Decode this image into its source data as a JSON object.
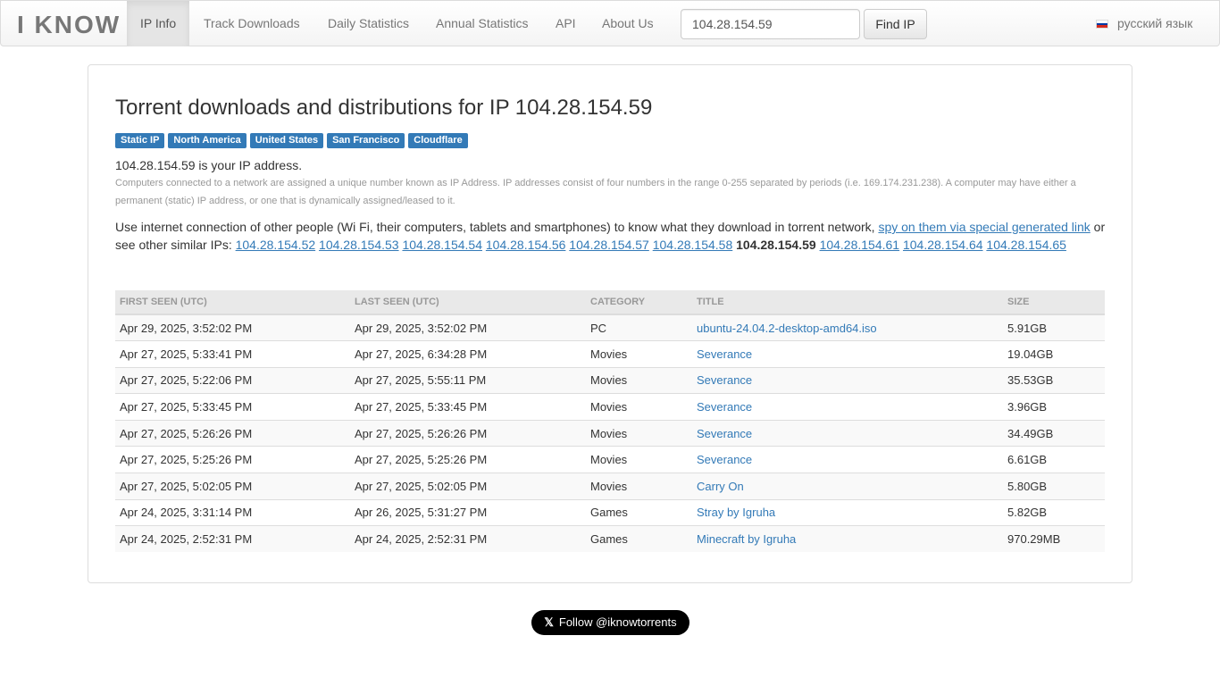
{
  "navbar": {
    "brand": "I KNOW",
    "items": [
      {
        "label": "IP Info"
      },
      {
        "label": "Track Downloads"
      },
      {
        "label": "Daily Statistics"
      },
      {
        "label": "Annual Statistics"
      },
      {
        "label": "API"
      },
      {
        "label": "About Us"
      }
    ],
    "search_value": "104.28.154.59",
    "find_label": "Find IP",
    "lang_label": "русский язык",
    "flag_colors": [
      "#ffffff",
      "#0039a6",
      "#d52b1e"
    ]
  },
  "main": {
    "title": "Torrent downloads and distributions for IP 104.28.154.59",
    "labels": [
      "Static IP",
      "North America",
      "United States",
      "San Francisco",
      "Cloudflare"
    ],
    "your_ip": "104.28.154.59 is your IP address.",
    "explain": "Computers connected to a network are assigned a unique number known as IP Address. IP addresses consist of four numbers in the range 0-255 separated by periods (i.e. 169.174.231.238). A computer may have either a permanent (static) IP address, or one that is dynamically assigned/leased to it.",
    "similar_text_1": "Use internet connection of other people (Wi Fi, their computers, tablets and smartphones) to know what they download in torrent network, ",
    "spy_link": "spy on them via special generated link",
    "similar_text_2": " or see other similar IPs: ",
    "similar_ips": [
      "104.28.154.52",
      "104.28.154.53",
      "104.28.154.54",
      "104.28.154.56",
      "104.28.154.57",
      "104.28.154.58",
      "104.28.154.59",
      "104.28.154.61",
      "104.28.154.64",
      "104.28.154.65"
    ],
    "current_ip": "104.28.154.59",
    "accent": "#337ab7"
  },
  "table": {
    "headers": [
      "FIRST SEEN (UTC)",
      "LAST SEEN (UTC)",
      "CATEGORY",
      "TITLE",
      "SIZE"
    ],
    "rows": [
      [
        "Apr 29, 2025, 3:52:02 PM",
        "Apr 29, 2025, 3:52:02 PM",
        "PC",
        "ubuntu-24.04.2-desktop-amd64.iso",
        "5.91GB"
      ],
      [
        "Apr 27, 2025, 5:33:41 PM",
        "Apr 27, 2025, 6:34:28 PM",
        "Movies",
        "Severance",
        "19.04GB"
      ],
      [
        "Apr 27, 2025, 5:22:06 PM",
        "Apr 27, 2025, 5:55:11 PM",
        "Movies",
        "Severance",
        "35.53GB"
      ],
      [
        "Apr 27, 2025, 5:33:45 PM",
        "Apr 27, 2025, 5:33:45 PM",
        "Movies",
        "Severance",
        "3.96GB"
      ],
      [
        "Apr 27, 2025, 5:26:26 PM",
        "Apr 27, 2025, 5:26:26 PM",
        "Movies",
        "Severance",
        "34.49GB"
      ],
      [
        "Apr 27, 2025, 5:25:26 PM",
        "Apr 27, 2025, 5:25:26 PM",
        "Movies",
        "Severance",
        "6.61GB"
      ],
      [
        "Apr 27, 2025, 5:02:05 PM",
        "Apr 27, 2025, 5:02:05 PM",
        "Movies",
        "Carry On",
        "5.80GB"
      ],
      [
        "Apr 24, 2025, 3:31:14 PM",
        "Apr 26, 2025, 5:31:27 PM",
        "Games",
        "Stray by Igruha",
        "5.82GB"
      ],
      [
        "Apr 24, 2025, 2:52:31 PM",
        "Apr 24, 2025, 2:52:31 PM",
        "Games",
        "Minecraft by Igruha",
        "970.29MB"
      ]
    ]
  },
  "footer": {
    "follow_label": "Follow @iknowtorrents",
    "x_icon": "𝕏"
  }
}
